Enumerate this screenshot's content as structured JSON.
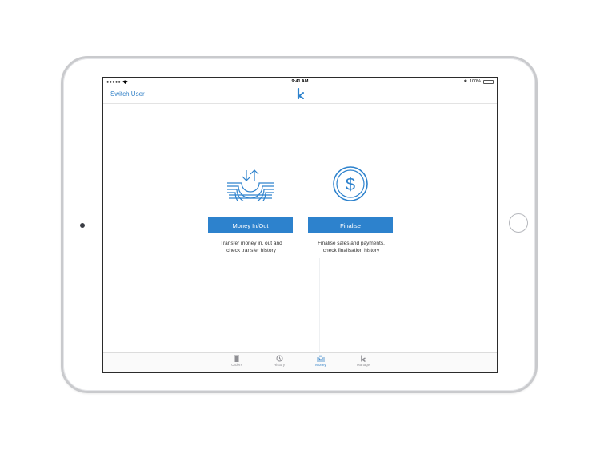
{
  "status_bar": {
    "signal": "●●●●● ",
    "time": "9:41 AM",
    "bluetooth": "✱",
    "battery_text": "100%",
    "battery_level": 1.0
  },
  "nav": {
    "switch_user_label": "Switch User",
    "logo_icon": "k-logo-icon"
  },
  "cards": [
    {
      "icon": "money-transfer-icon",
      "button_label": "Money In/Out",
      "description_line1": "Transfer money in, out and",
      "description_line2": "check transfer history"
    },
    {
      "icon": "dollar-circle-icon",
      "button_label": "Finalise",
      "description_line1": "Finalise sales and payments,",
      "description_line2": "check finalisation history"
    }
  ],
  "tabs": [
    {
      "label": "Orders",
      "icon": "trash-icon",
      "active": false
    },
    {
      "label": "History",
      "icon": "history-icon",
      "active": false
    },
    {
      "label": "Money",
      "icon": "money-tray-icon",
      "active": true
    },
    {
      "label": "Manage",
      "icon": "k-logo-icon",
      "active": false
    }
  ],
  "colors": {
    "accent": "#2d82cd",
    "link": "#2f7fc6",
    "tab_inactive": "#8e8e93",
    "battery": "#4cd964"
  }
}
